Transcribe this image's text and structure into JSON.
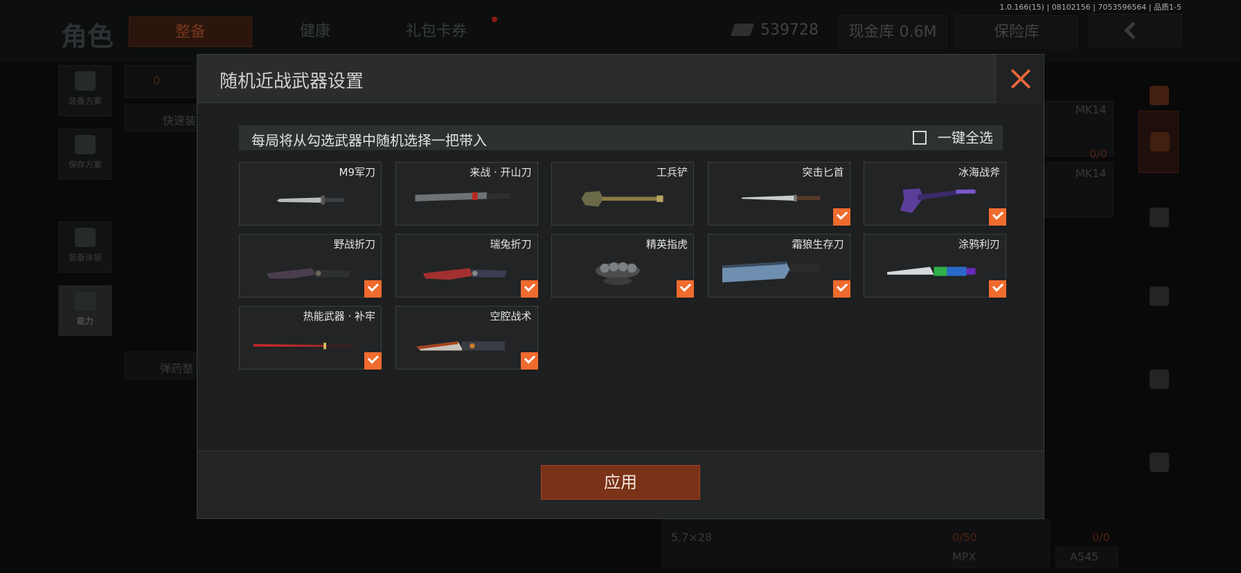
{
  "version": "1.0.166(15) | 08102156 | 7053596564 | 品质1-5",
  "background": {
    "page_title": "角色",
    "tabs": [
      {
        "label": "整备",
        "active": true
      },
      {
        "label": "健康",
        "active": false
      },
      {
        "label": "礼包卡券",
        "active": false
      }
    ],
    "currency": "539728",
    "cash_vault": "现金库 0.6M",
    "safe": "保险库",
    "left_rail": [
      {
        "label": "装备方案",
        "icon": "vest-icon"
      },
      {
        "label": "保存方案",
        "icon": "download-icon"
      },
      {
        "label": "装备涂装",
        "icon": "helmet-icon"
      },
      {
        "label": "能力",
        "icon": "lightning-shield-icon"
      }
    ],
    "quick_equip": "快速装",
    "ammo_tidy": "弹药整",
    "count_zero": "0",
    "right_labels": [
      "MK14",
      "0/0",
      "MK14"
    ],
    "bottom_labels": [
      "5.7×28",
      "0/50",
      "MPX",
      "0/0",
      "A545"
    ]
  },
  "modal": {
    "title": "随机近战武器设置",
    "info": "每局将从勾选武器中随机选择一把带入",
    "select_all": "一键全选",
    "select_all_checked": false,
    "apply": "应用",
    "weapons": [
      {
        "name": "M9军刀",
        "checked": false,
        "icon": "bayonet-icon"
      },
      {
        "name": "来战 · 开山刀",
        "checked": false,
        "icon": "machete-icon"
      },
      {
        "name": "工兵铲",
        "checked": false,
        "icon": "shovel-icon"
      },
      {
        "name": "突击匕首",
        "checked": true,
        "icon": "dagger-icon"
      },
      {
        "name": "冰海战斧",
        "checked": true,
        "icon": "axe-icon"
      },
      {
        "name": "野战折刀",
        "checked": true,
        "icon": "folding-knife-icon"
      },
      {
        "name": "瑞兔折刀",
        "checked": true,
        "icon": "folding-knife-red-icon"
      },
      {
        "name": "精英指虎",
        "checked": true,
        "icon": "knuckles-icon"
      },
      {
        "name": "霜狼生存刀",
        "checked": true,
        "icon": "survival-knife-icon"
      },
      {
        "name": "涂鸦利刃",
        "checked": true,
        "icon": "graffiti-blade-icon"
      },
      {
        "name": "热能武器 · 补牢",
        "checked": true,
        "icon": "katana-icon"
      },
      {
        "name": "空腔战术",
        "checked": true,
        "icon": "tactical-knife-icon"
      }
    ]
  },
  "colors": {
    "accent": "#f06b2e",
    "apply_button": "#7a3218"
  }
}
